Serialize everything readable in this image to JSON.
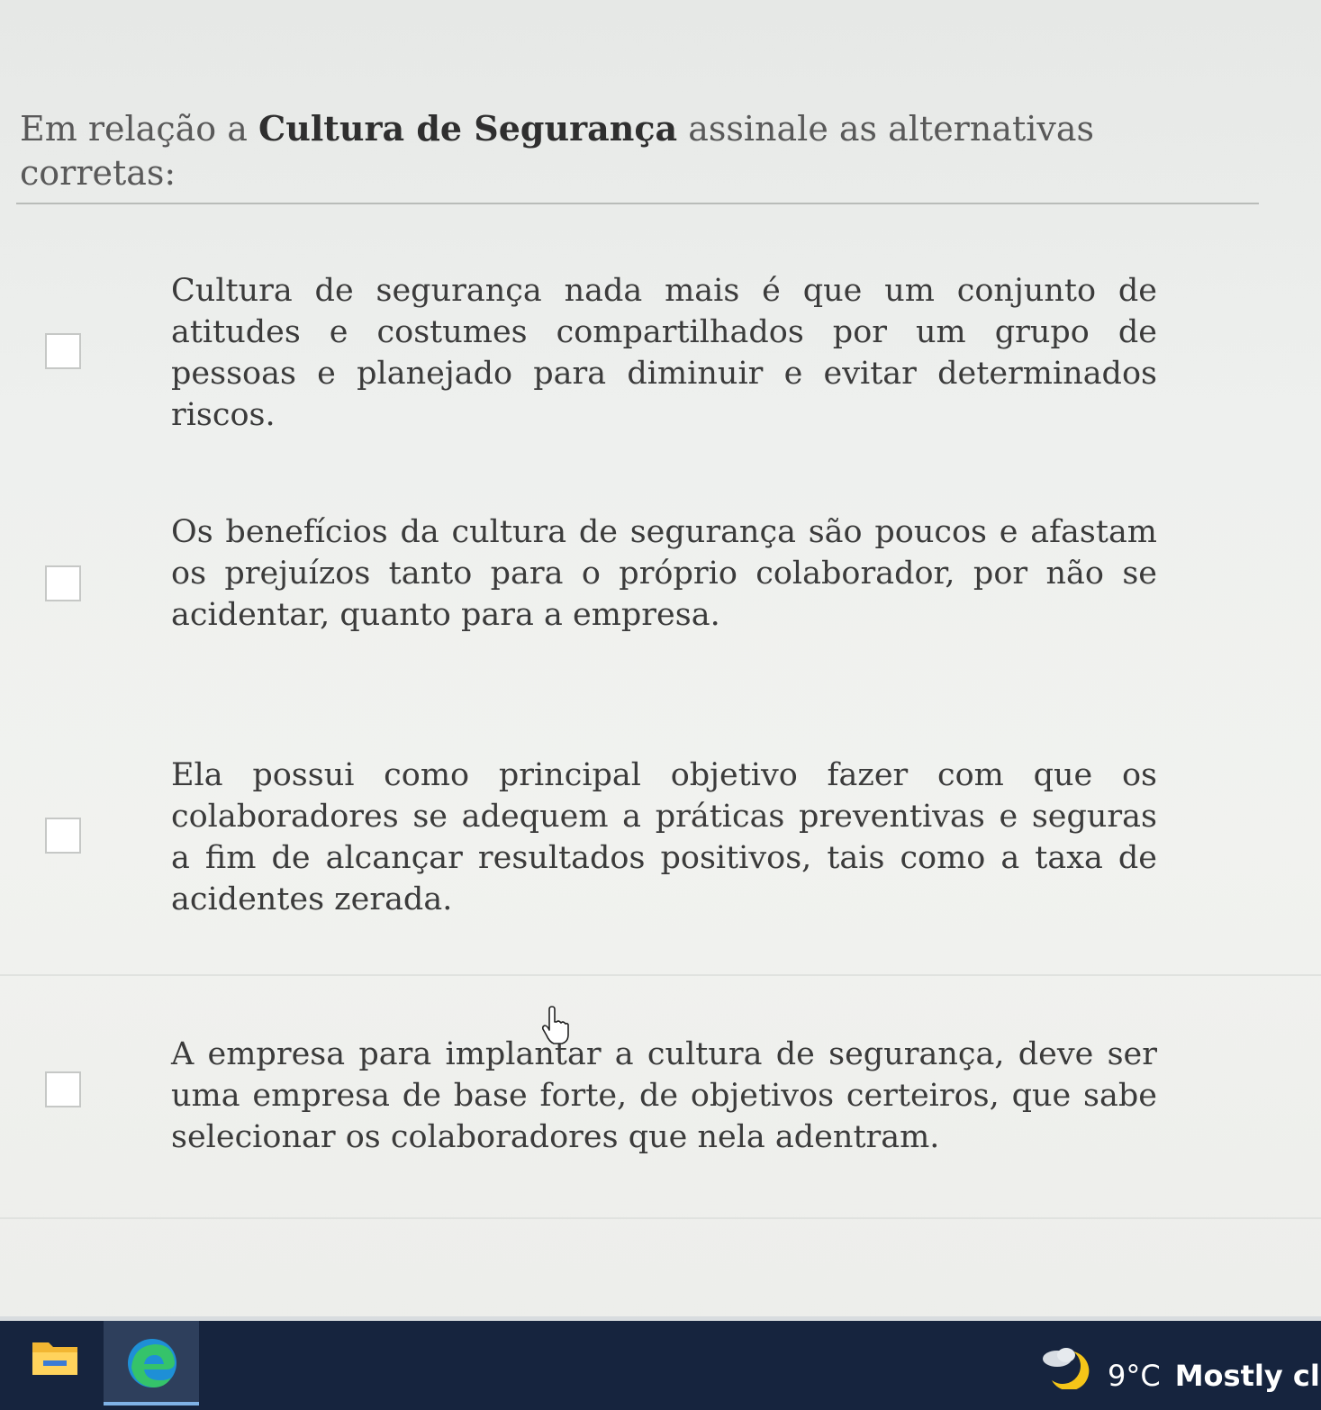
{
  "question": {
    "prefix": "Em relação a ",
    "topic": "Cultura de Segurança",
    "suffix": " assinale as alternativas corretas:"
  },
  "options": [
    {
      "text": "Cultura de segurança nada mais é que um conjunto de atitudes e costumes compartilhados por um grupo de pessoas e planejado para diminuir e evitar determinados riscos.",
      "checked": false
    },
    {
      "text": "Os benefícios da cultura de segurança são poucos e afastam os prejuízos tanto para o próprio colaborador, por não se acidentar, quanto para a empresa.",
      "checked": false
    },
    {
      "text": "Ela possui como principal objetivo fazer com que os colaboradores se adequem a práticas preventivas e seguras a fim de alcançar resultados positivos, tais como a taxa de acidentes zerada.",
      "checked": false
    },
    {
      "text": "A empresa para implantar a cultura de segurança, deve ser uma empresa de base forte, de objetivos certeiros, que sabe selecionar os colaboradores que nela adentram.",
      "checked": false
    }
  ],
  "taskbar": {
    "apps": [
      {
        "icon": "file-explorer-icon"
      },
      {
        "icon": "edge-icon",
        "active": true
      }
    ],
    "weather": {
      "icon": "moon-cloud-icon",
      "temperature": "9°C",
      "condition": "Mostly clea"
    }
  },
  "colors": {
    "taskbar_bg": "#16243e",
    "active_app_indicator": "#7fb2e6",
    "question_text": "#595959",
    "option_text": "#3b3b3b"
  }
}
